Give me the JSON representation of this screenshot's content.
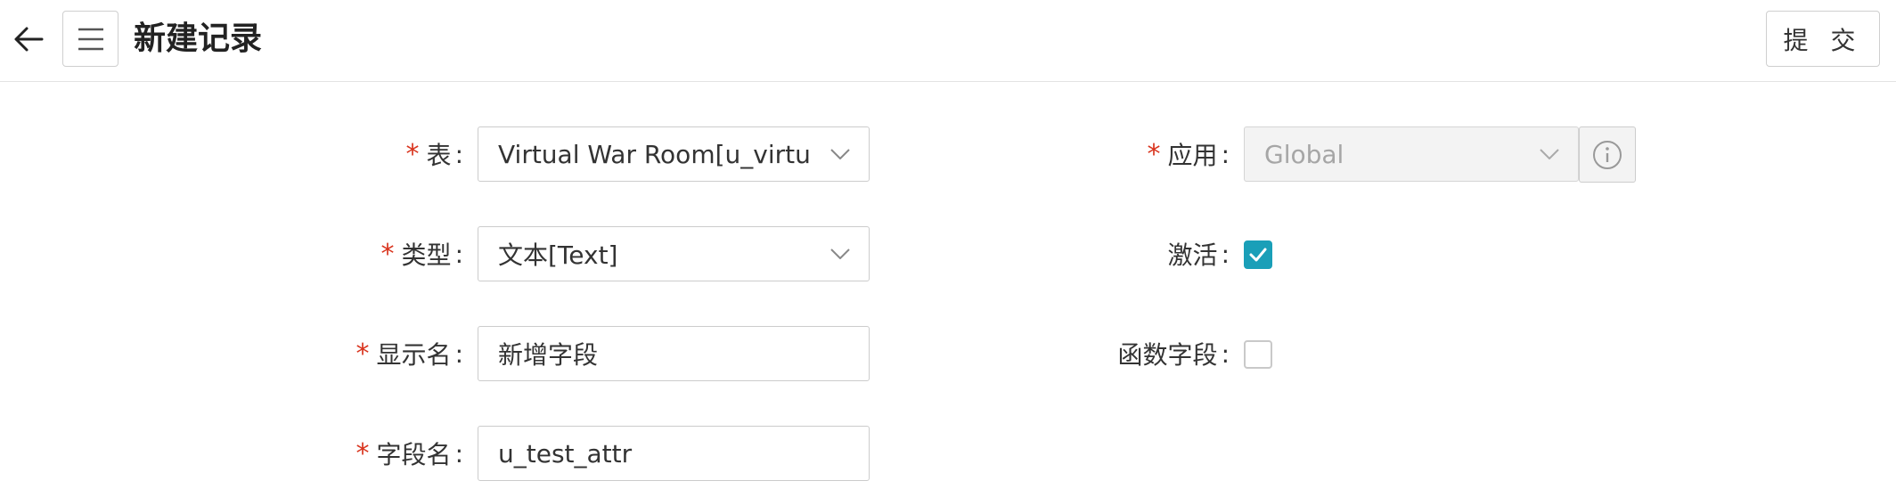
{
  "header": {
    "title": "新建记录",
    "submit_label": "提 交",
    "back_icon": "arrow-left-icon",
    "menu_icon": "hamburger-menu-icon"
  },
  "form": {
    "table": {
      "required_mark": "*",
      "label": "表",
      "colon": ":",
      "value": "Virtual War Room[u_virtu..."
    },
    "type": {
      "required_mark": "*",
      "label": "类型",
      "colon": ":",
      "value": "文本[Text]"
    },
    "display_name": {
      "required_mark": "*",
      "label": "显示名",
      "colon": ":",
      "value": "新增字段"
    },
    "field_name": {
      "required_mark": "*",
      "label": "字段名",
      "colon": ":",
      "value": "u_test_attr"
    },
    "application": {
      "required_mark": "*",
      "label": "应用",
      "colon": ":",
      "value": "Global",
      "disabled": true,
      "info_icon": "info-circle-icon"
    },
    "active": {
      "label": "激活",
      "colon": ":",
      "checked": true
    },
    "function_field": {
      "label": "函数字段",
      "colon": ":",
      "checked": false
    }
  },
  "colors": {
    "required": "#d9341e",
    "checkbox_on": "#1a9fb8",
    "border": "#cccccc",
    "disabled_bg": "#f3f3f3"
  }
}
